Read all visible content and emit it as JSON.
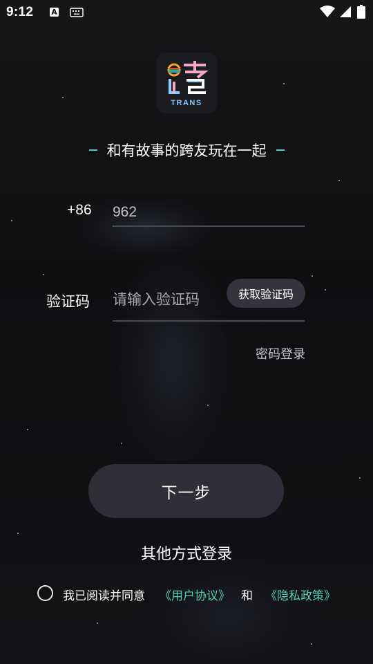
{
  "status_bar": {
    "time": "9:12",
    "notification_icon_letter": "A"
  },
  "logo": {
    "text": "TRANS",
    "icon": "app-logo-icon"
  },
  "slogan": "和有故事的跨友玩在一起",
  "phone": {
    "country_code": "+86",
    "value": "962"
  },
  "code": {
    "label": "验证码",
    "placeholder": "请输入验证码",
    "get_code_label": "获取验证码"
  },
  "password_login_label": "密码登录",
  "next_label": "下一步",
  "other_login_label": "其他方式登录",
  "agreement": {
    "prefix": "我已阅读并同意",
    "user_agreement": "《用户协议》",
    "and": "和",
    "privacy_policy": "《隐私政策》"
  },
  "colors": {
    "accent_teal": "#55cdb8",
    "button_dark": "#2e2f38",
    "background": "#111215"
  }
}
